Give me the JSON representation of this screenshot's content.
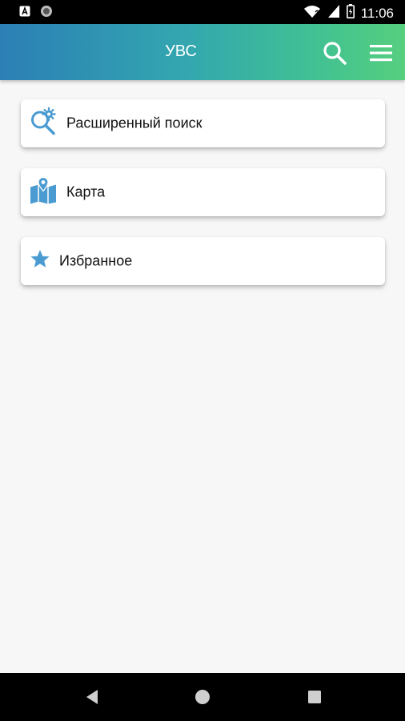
{
  "status_bar": {
    "time": "11:06",
    "icons": [
      "app-a-icon",
      "circle-dot-icon",
      "wifi-icon",
      "signal-icon",
      "battery-icon"
    ]
  },
  "app_bar": {
    "title": "УВС",
    "background_gradient": [
      "#2b7fb5",
      "#56cf7e"
    ],
    "actions": [
      "search-icon",
      "menu-icon"
    ]
  },
  "menu": {
    "items": [
      {
        "label": "Расширенный поиск",
        "icon": "advanced-search-icon"
      },
      {
        "label": "Карта",
        "icon": "map-icon"
      },
      {
        "label": "Избранное",
        "icon": "star-icon"
      }
    ]
  },
  "colors": {
    "accent_icon": "#4a9bd1",
    "background": "#f7f7f7"
  },
  "nav_bar": {
    "buttons": [
      "back-icon",
      "home-icon",
      "recents-icon"
    ]
  }
}
